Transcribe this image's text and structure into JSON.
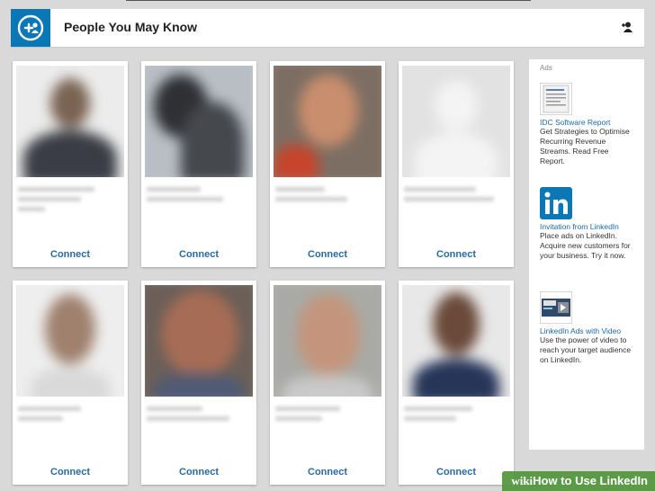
{
  "header": {
    "title": "People You May Know",
    "icon": "add-connection-icon",
    "right_icon": "person-add-icon",
    "accent": "#0b77b5"
  },
  "cards": [
    {
      "connect_label": "Connect"
    },
    {
      "connect_label": "Connect"
    },
    {
      "connect_label": "Connect"
    },
    {
      "connect_label": "Connect"
    },
    {
      "connect_label": "Connect"
    },
    {
      "connect_label": "Connect"
    },
    {
      "connect_label": "Connect"
    },
    {
      "connect_label": "Connect"
    }
  ],
  "ads": {
    "title": "Ads",
    "items": [
      {
        "title": "IDC Software Report",
        "text": "Get Strategies to Optimise Recurring Revenue Streams. Read Free Report."
      },
      {
        "title": "Invitation from LinkedIn",
        "text": "Place ads on LinkedIn. Acquire new customers for your business. Try it now."
      },
      {
        "title": "LinkedIn Ads with Video",
        "text": "Use the power of video to reach your target audience on LinkedIn."
      }
    ]
  },
  "watermark": {
    "brand": "wiki",
    "text": "How to Use LinkedIn"
  }
}
